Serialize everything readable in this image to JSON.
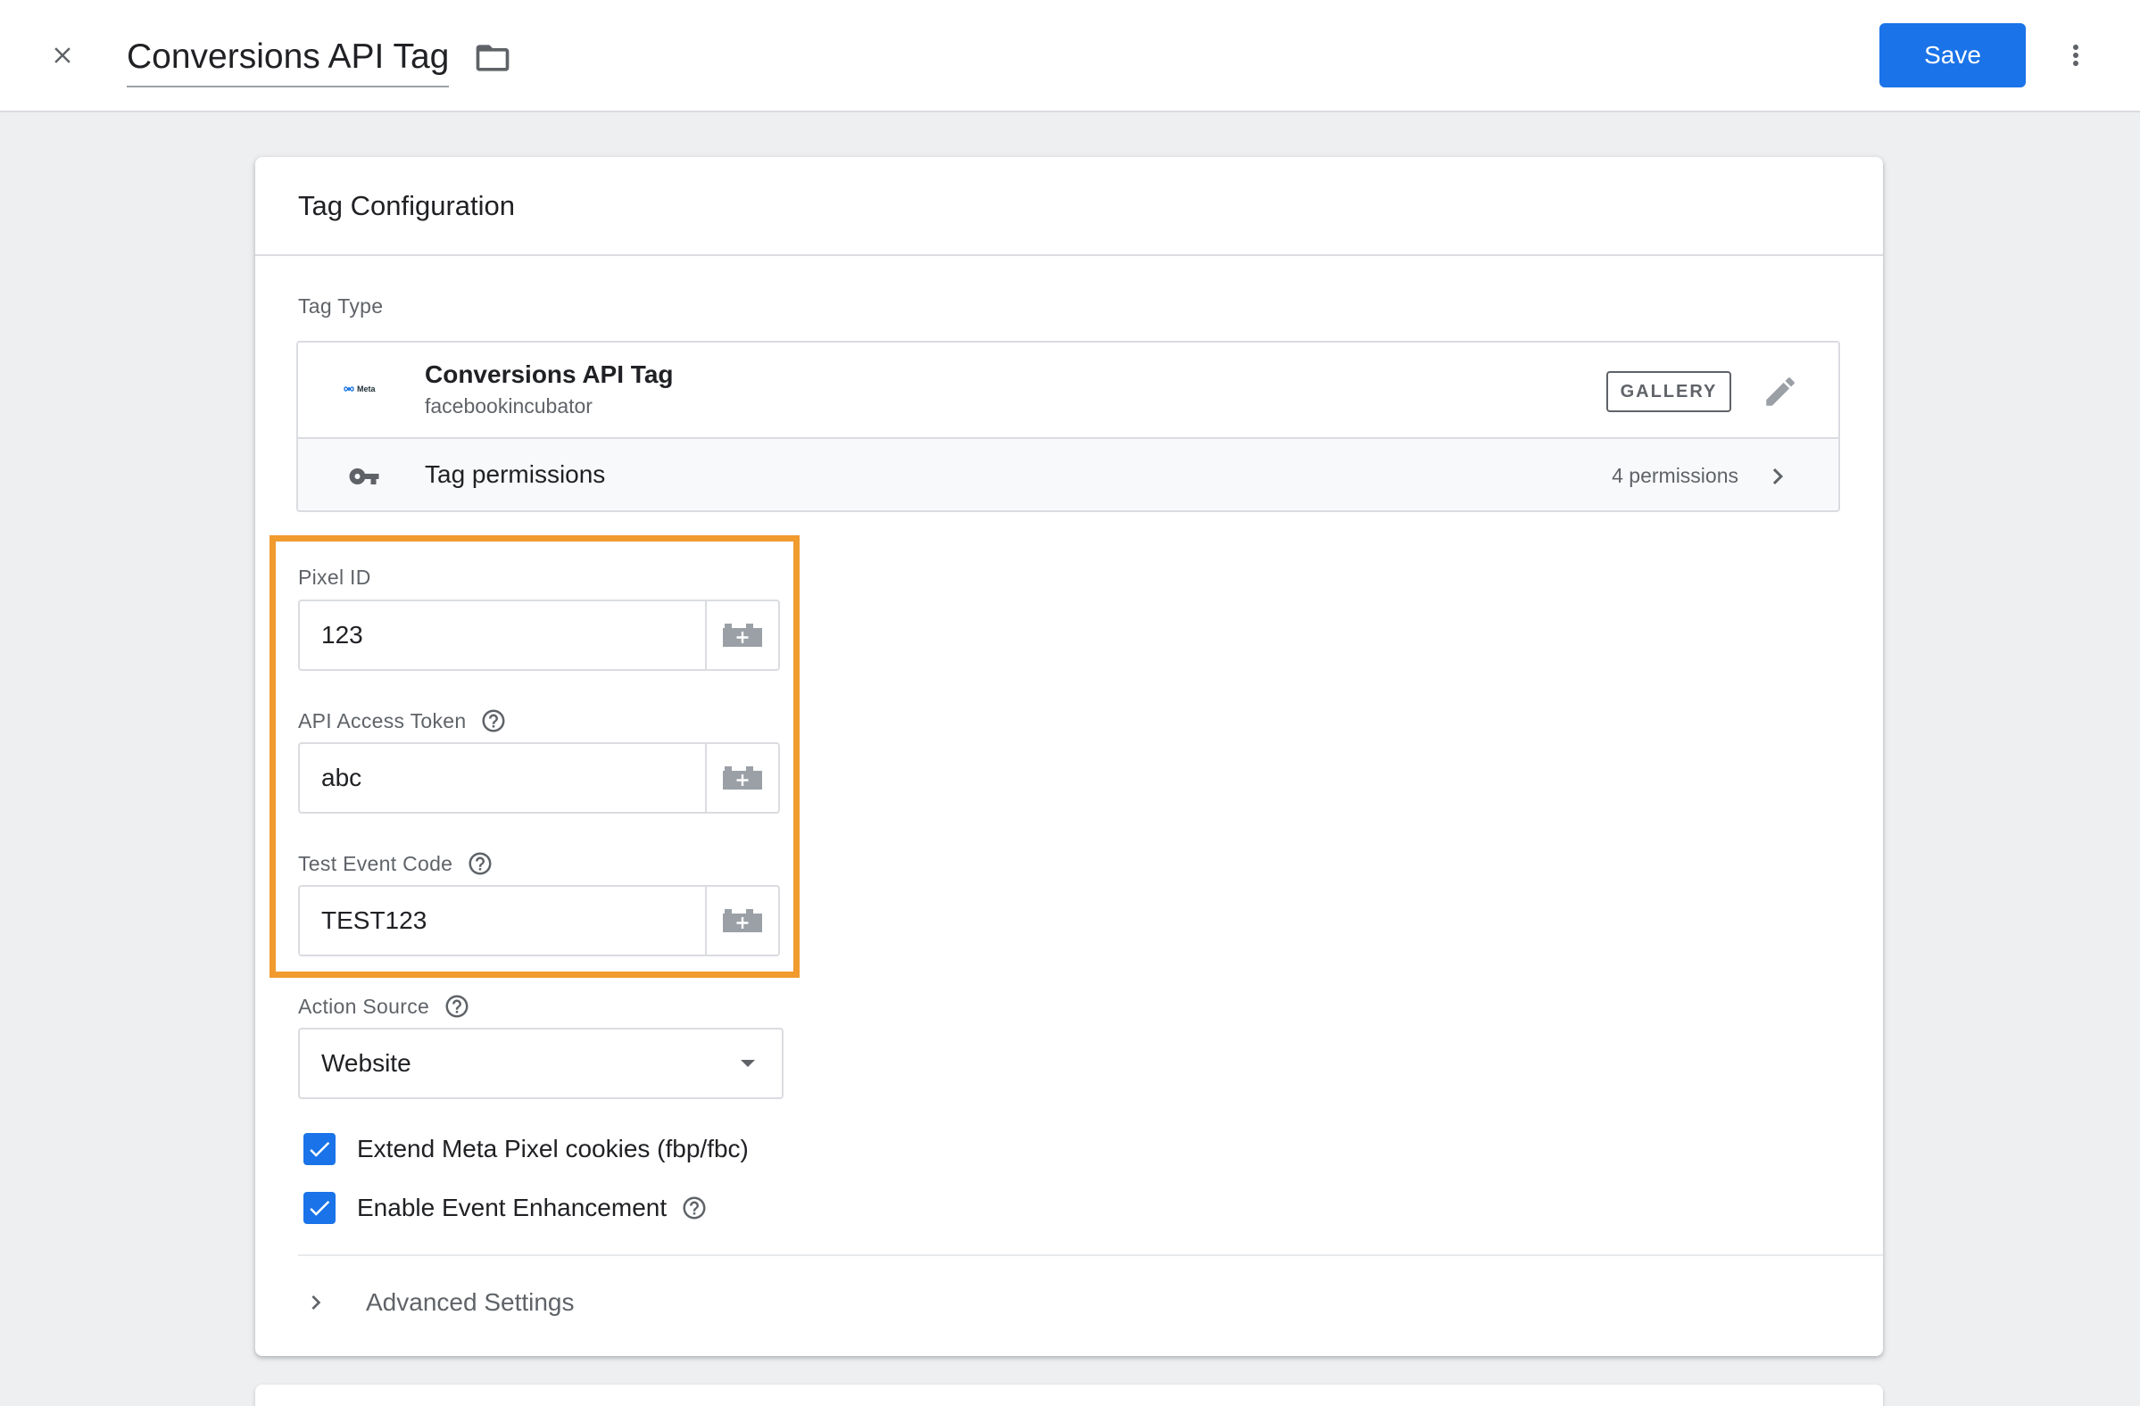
{
  "header": {
    "title": "Conversions API Tag",
    "save_label": "Save"
  },
  "card": {
    "title": "Tag Configuration",
    "tag_type_label": "Tag Type",
    "tag_type": {
      "logo_text": "Meta",
      "name": "Conversions API Tag",
      "publisher": "facebookincubator",
      "badge": "GALLERY"
    },
    "permissions": {
      "label": "Tag permissions",
      "count": "4 permissions"
    },
    "fields": {
      "pixel_id": {
        "label": "Pixel ID",
        "value": "123"
      },
      "api_access_token": {
        "label": "API Access Token",
        "value": "abc"
      },
      "test_event_code": {
        "label": "Test Event Code",
        "value": "TEST123"
      }
    },
    "action_source": {
      "label": "Action Source",
      "value": "Website"
    },
    "checkboxes": [
      {
        "label": "Extend Meta Pixel cookies (fbp/fbc)",
        "checked": true
      },
      {
        "label": "Enable Event Enhancement",
        "checked": true
      }
    ],
    "advanced_settings": "Advanced Settings"
  },
  "colors": {
    "accent": "#1a73e8",
    "highlight": "#f19a2e"
  },
  "icons": [
    "close-icon",
    "folder-icon",
    "more-vert-icon",
    "meta-logo",
    "pencil-icon",
    "key-icon",
    "chevron-right-icon",
    "variable-icon",
    "help-icon",
    "dropdown-arrow-icon",
    "check-icon"
  ]
}
